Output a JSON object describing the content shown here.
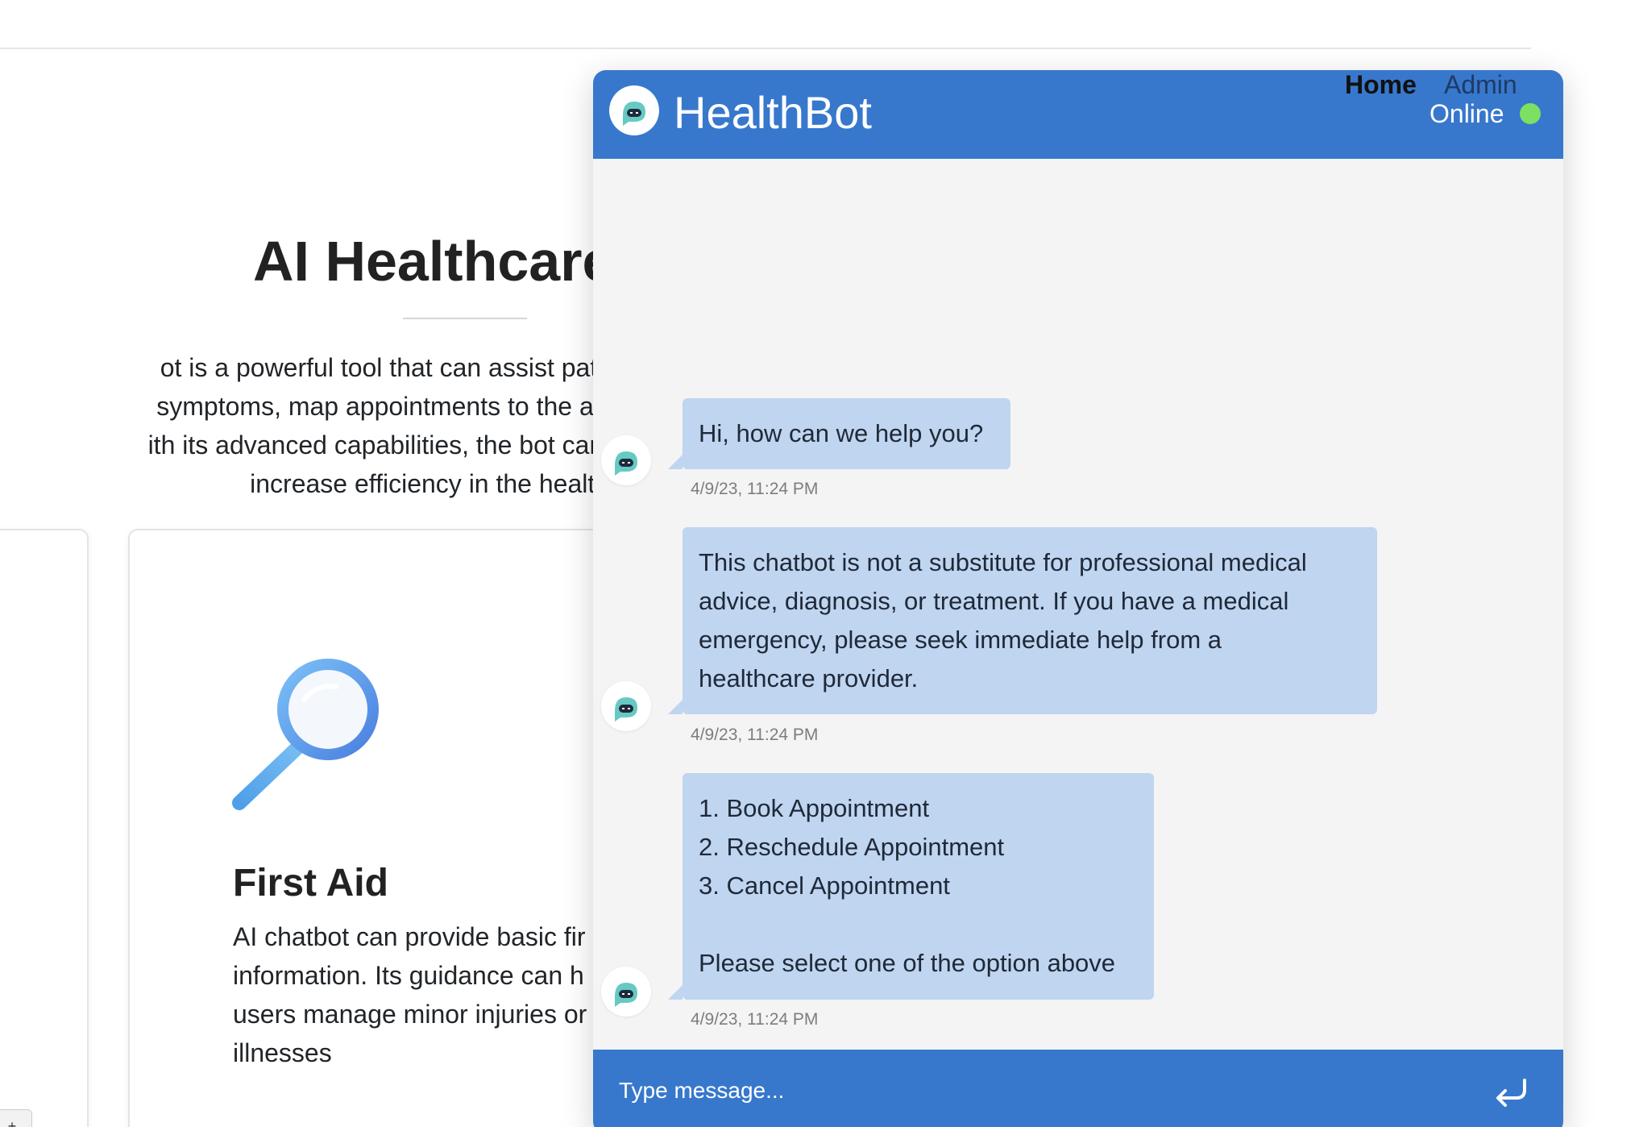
{
  "page": {
    "hero_title": "AI Healthcare",
    "hero_lines": [
      "ot is a powerful tool that can assist patients with b",
      "symptoms, map appointments to the appropriate c",
      "ith its advanced capabilities, the bot can improve pa",
      "increase efficiency in the healthca"
    ],
    "card": {
      "icon": "magnifier-icon",
      "title": "First Aid",
      "lines": [
        "AI chatbot can provide basic fir",
        "information. Its guidance can h",
        "users manage minor injuries or",
        "illnesses"
      ]
    },
    "corner_tab": "+"
  },
  "chat": {
    "title": "HealthBot",
    "logo_icon": "chatbot-robot-icon",
    "nav": {
      "home": "Home",
      "admin": "Admin"
    },
    "status": "Online",
    "status_color": "#7ee063",
    "header_color": "#3778cc",
    "bubble_color": "#bfd5f0",
    "messages": [
      {
        "sender": "bot",
        "lines": [
          "Hi, how can we help you?"
        ],
        "time": "4/9/23, 11:24 PM"
      },
      {
        "sender": "bot",
        "lines": [
          "This chatbot is not a substitute for professional medical",
          "advice, diagnosis, or treatment. If you have a medical",
          "emergency, please seek immediate help from a",
          "healthcare provider."
        ],
        "time": "4/9/23, 11:24 PM"
      },
      {
        "sender": "bot",
        "lines": [
          "1. Book Appointment",
          "2. Reschedule Appointment",
          "3. Cancel Appointment",
          "",
          "Please select one of the option above"
        ],
        "time": "4/9/23, 11:24 PM"
      }
    ],
    "input": {
      "placeholder": "Type message...",
      "value": ""
    },
    "send_icon": "enter-arrow-icon"
  }
}
